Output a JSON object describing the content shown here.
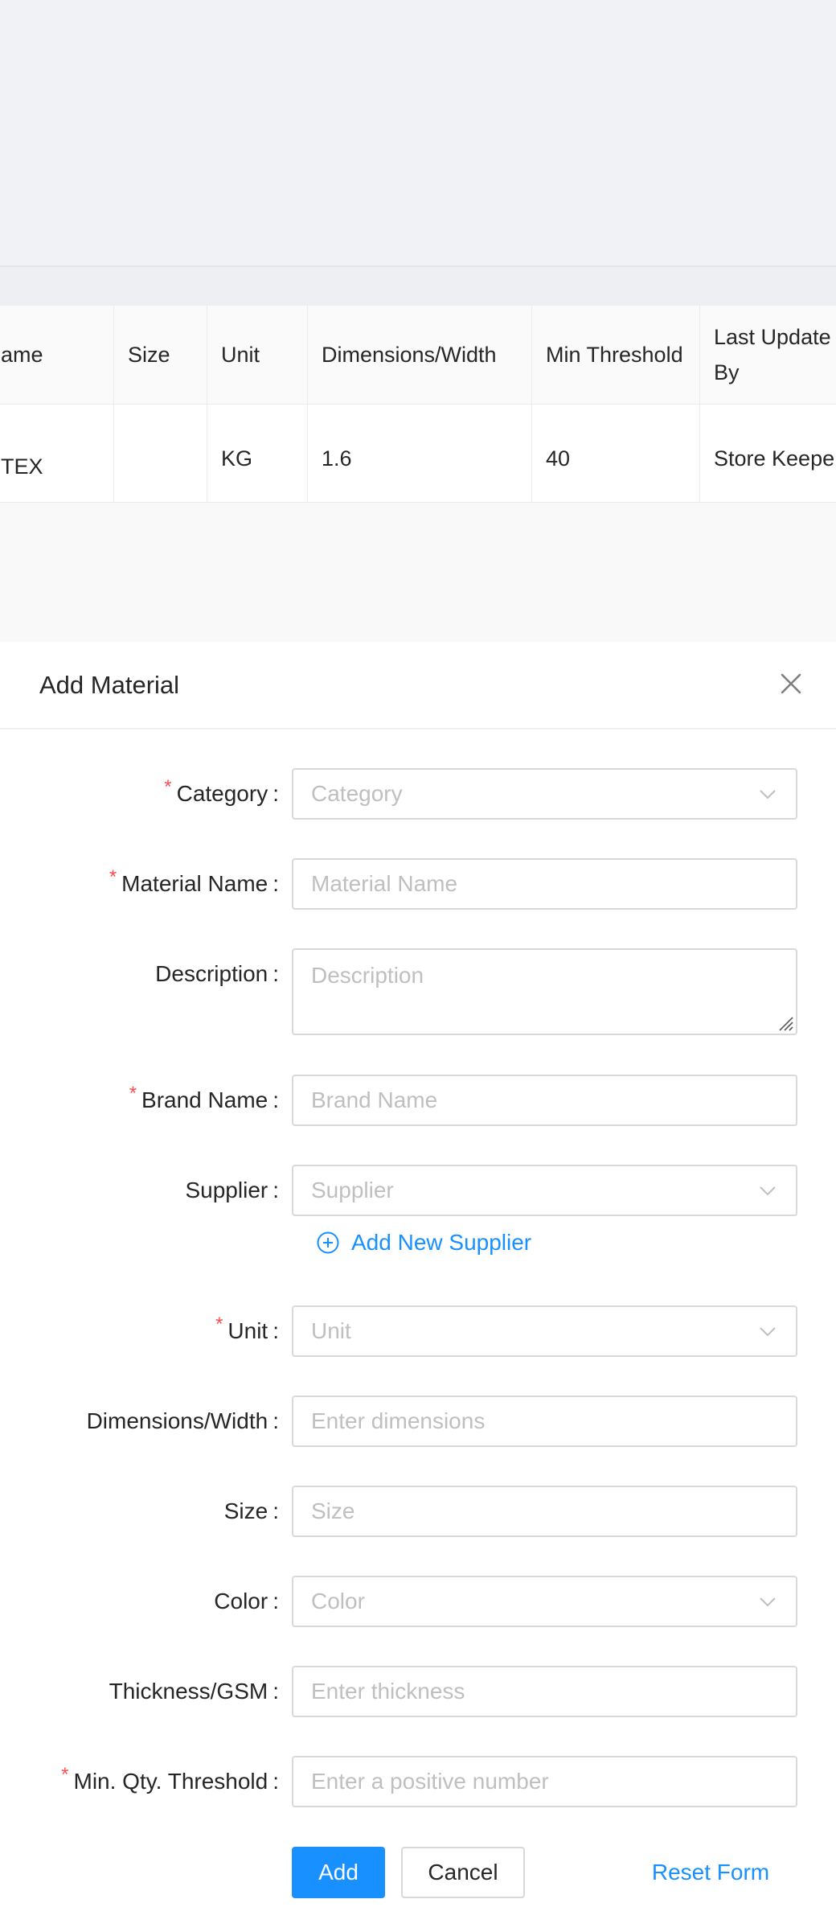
{
  "table": {
    "headers": [
      "ame",
      "Size",
      "Unit",
      "Dimensions/Width",
      "Min Threshold",
      "Last Update By"
    ],
    "rows": [
      [
        "TEX",
        "",
        "KG",
        "1.6",
        "40",
        "Store Keepe"
      ]
    ]
  },
  "drawer": {
    "title": "Add Material",
    "fields": {
      "category": {
        "label": "Category",
        "placeholder": "Category",
        "required": true
      },
      "material_name": {
        "label": "Material Name",
        "placeholder": "Material Name",
        "required": true
      },
      "description": {
        "label": "Description",
        "placeholder": "Description",
        "required": false
      },
      "brand_name": {
        "label": "Brand Name",
        "placeholder": "Brand Name",
        "required": true
      },
      "supplier": {
        "label": "Supplier",
        "placeholder": "Supplier",
        "required": false
      },
      "unit": {
        "label": "Unit",
        "placeholder": "Unit",
        "required": true
      },
      "dimensions": {
        "label": "Dimensions/Width",
        "placeholder": "Enter dimensions",
        "required": false
      },
      "size": {
        "label": "Size",
        "placeholder": "Size",
        "required": false
      },
      "color": {
        "label": "Color",
        "placeholder": "Color",
        "required": false
      },
      "thickness": {
        "label": "Thickness/GSM",
        "placeholder": "Enter thickness",
        "required": false
      },
      "min_qty": {
        "label": "Min. Qty. Threshold",
        "placeholder": "Enter a positive number",
        "required": true
      }
    },
    "add_supplier_label": "Add New Supplier",
    "buttons": {
      "add": "Add",
      "cancel": "Cancel",
      "reset": "Reset Form"
    },
    "required_mark": "*",
    "colon": ":"
  },
  "colors": {
    "primary": "#1890ff",
    "required": "#ff4d4f",
    "placeholder": "#bfbfbf"
  }
}
